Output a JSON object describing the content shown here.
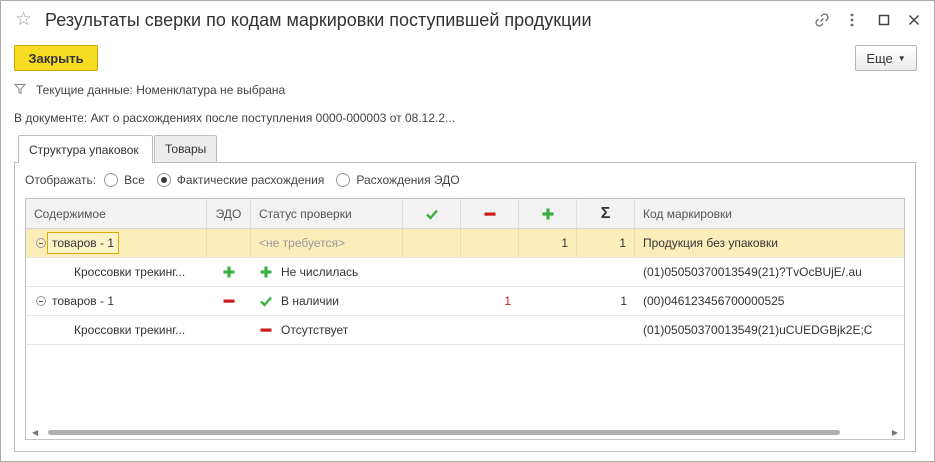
{
  "window": {
    "title": "Результаты сверки по кодам маркировки поступившей продукции",
    "icons": [
      "star-icon",
      "link-icon",
      "more-vertical-icon",
      "maximize-icon",
      "close-icon"
    ]
  },
  "toolbar": {
    "close_label": "Закрыть",
    "more_label": "Еще"
  },
  "info": {
    "filter_text": "Текущие данные: Номенклатура не выбрана",
    "document_text": "В документе:  Акт о расхождениях после поступления 0000-000003 от 08.12.2..."
  },
  "tabs": [
    {
      "label": "Структура упаковок",
      "active": true
    },
    {
      "label": "Товары",
      "active": false
    }
  ],
  "display_filter": {
    "label": "Отображать:",
    "options": [
      {
        "label": "Все",
        "checked": false
      },
      {
        "label": "Фактические расхождения",
        "checked": true
      },
      {
        "label": "Расхождения ЭДО",
        "checked": false
      }
    ]
  },
  "table": {
    "columns": {
      "content": "Содержимое",
      "edo": "ЭДО",
      "status": "Статус проверки",
      "check_icon": "check-icon",
      "minus_icon": "minus-icon",
      "plus_icon": "plus-icon",
      "sum_icon": "Σ",
      "code": "Код маркировки"
    },
    "rows": [
      {
        "content": "товаров - 1",
        "edo": "",
        "status": "<не требуется>",
        "c_check": "",
        "c_minus": "",
        "c_plus": "1",
        "c_sum": "1",
        "code": "Продукция без упаковки"
      },
      {
        "content": "Кроссовки трекинг...",
        "edo": "plus",
        "status": "Не числилась",
        "status_icon": "plus",
        "c_check": "",
        "c_minus": "",
        "c_plus": "",
        "c_sum": "",
        "code": "(01)05050370013549(21)?TvOcBUjE/.au"
      },
      {
        "content": "товаров - 1",
        "edo": "minus",
        "status": "В наличии",
        "status_icon": "check",
        "c_check": "",
        "c_minus": "1",
        "c_plus": "",
        "c_sum": "1",
        "code": "(00)046123456700000525"
      },
      {
        "content": "Кроссовки трекинг...",
        "edo": "",
        "status": "Отсутствует",
        "status_icon": "minus",
        "c_check": "",
        "c_minus": "",
        "c_plus": "",
        "c_sum": "",
        "code": "(01)05050370013549(21)uCUEDGBjk2E;C"
      }
    ]
  },
  "colors": {
    "accent_yellow": "#f8dc24",
    "selection": "#fbeebb",
    "green": "#3cb043",
    "red": "#d01b1b"
  }
}
